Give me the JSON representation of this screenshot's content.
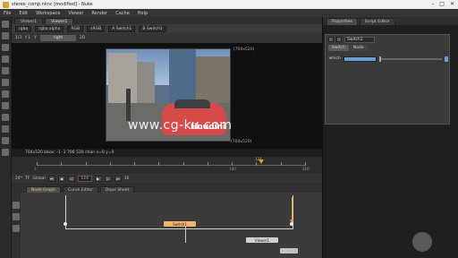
{
  "window": {
    "title": "stereo_comp.nknc [modified] - Nuke",
    "controls": [
      "–",
      "□",
      "✕"
    ]
  },
  "menu": [
    "File",
    "Edit",
    "Workspace",
    "Viewer",
    "Render",
    "Cache",
    "Help"
  ],
  "viewer": {
    "tabs": [
      "Viewer1",
      "Viewer1"
    ],
    "channels": "rgba",
    "alpha": "rgba.alpha",
    "colorspace": "RGB",
    "lut": "sRGB",
    "input_a": "A  Switch1",
    "input_b": "B  Switch1",
    "zoom": "1/3",
    "gain": "f  1",
    "frame_label": "Y",
    "right_button": "right",
    "mode": "2D",
    "format_top": "(704x520)",
    "format_bottom": "(704x520)",
    "infobar": "704x520   bbox: -1 -1 706 530 chan  x=0 y=0",
    "overlay_text": "Houdini",
    "watermark": "www.cg-ku.com"
  },
  "timeline": {
    "playhead_frame": "124",
    "ticks": [
      "1",
      "",
      "",
      "",
      "",
      "",
      "",
      "",
      "100",
      "",
      "",
      "110"
    ],
    "fps": "24*",
    "mode": "TF",
    "global": "Global",
    "current_frame": "124",
    "step": "10"
  },
  "nodegraph": {
    "tabs": [
      "Node Graph",
      "Curve Editor",
      "Dope Sheet"
    ],
    "nodes": {
      "switch": "Switch1",
      "viewer": "Viewer1",
      "small": ""
    }
  },
  "properties": {
    "tabs": [
      "Properties",
      "Script Editor"
    ],
    "node_name": "Switch1",
    "node_tabs": [
      "Switch",
      "Node"
    ],
    "which_label": "which"
  },
  "colors": {
    "accent": "#e89a2c",
    "switch_node": "#f2b36a",
    "which_field": "#6a9fd6"
  }
}
